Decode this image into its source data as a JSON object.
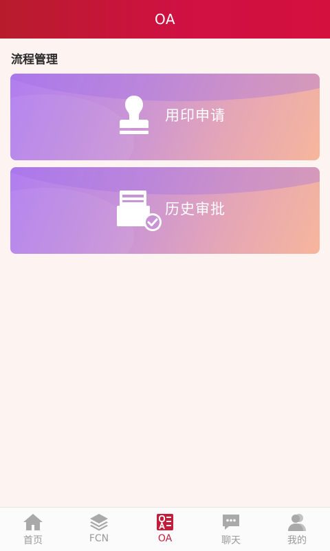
{
  "header": {
    "title": "OA"
  },
  "section": {
    "title": "流程管理"
  },
  "cards": [
    {
      "label": "用印申请",
      "icon": "stamp-icon"
    },
    {
      "label": "历史审批",
      "icon": "approval-history-icon"
    }
  ],
  "tabbar": {
    "active_index": 2,
    "active_color": "#c41d3a",
    "inactive_color": "#9a9a9a",
    "items": [
      {
        "label": "首页",
        "icon": "home-icon"
      },
      {
        "label": "FCN",
        "icon": "layers-icon"
      },
      {
        "label": "OA",
        "icon": "oa-icon"
      },
      {
        "label": "聊天",
        "icon": "chat-icon"
      },
      {
        "label": "我的",
        "icon": "user-icon"
      }
    ]
  },
  "colors": {
    "header": "#cf1142",
    "background": "#fdf3f0",
    "card_gradient_start": "#b07ef0",
    "card_gradient_end": "#f6b69c"
  }
}
